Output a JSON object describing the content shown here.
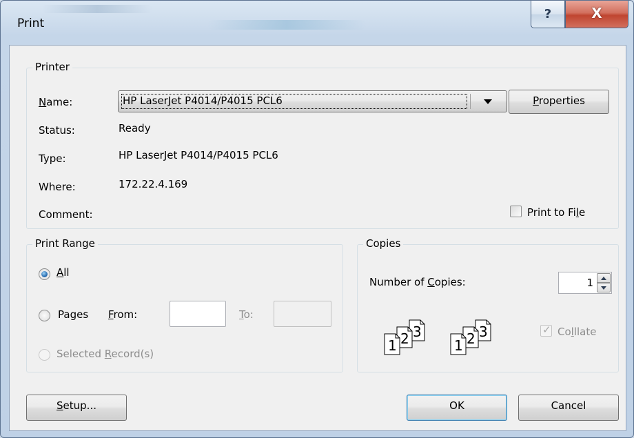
{
  "window": {
    "title": "Print",
    "help_glyph": "?",
    "close_glyph": "X"
  },
  "printer": {
    "group_label": "Printer",
    "name_rest": "ame:",
    "status_label": "Status:",
    "status_value": "Ready",
    "type_label": "Type:",
    "type_value": "HP LaserJet P4014/P4015 PCL6",
    "where_label": "Where:",
    "where_value": "172.22.4.169",
    "comment_label": "Comment:",
    "selected_printer": "HP LaserJet P4014/P4015 PCL6",
    "properties_rest": "roperties",
    "print_to_file_pre": "Print to Fi",
    "print_to_file_rest": "e"
  },
  "print_range": {
    "group_label": "Print Range",
    "all_rest": "ll",
    "pages_label": "Pages",
    "from_rest": "rom:",
    "to_rest": "o:",
    "selected_pre": "Selected ",
    "selected_rest": "ecord(s)",
    "selected_option": "All"
  },
  "copies": {
    "group_label": "Copies",
    "number_pre": "Number of ",
    "number_rest": "opies:",
    "count": "1",
    "collate_rest": "llate",
    "collate_checked": true
  },
  "buttons": {
    "setup_rest": "etup...",
    "ok": "OK",
    "cancel": "Cancel"
  }
}
